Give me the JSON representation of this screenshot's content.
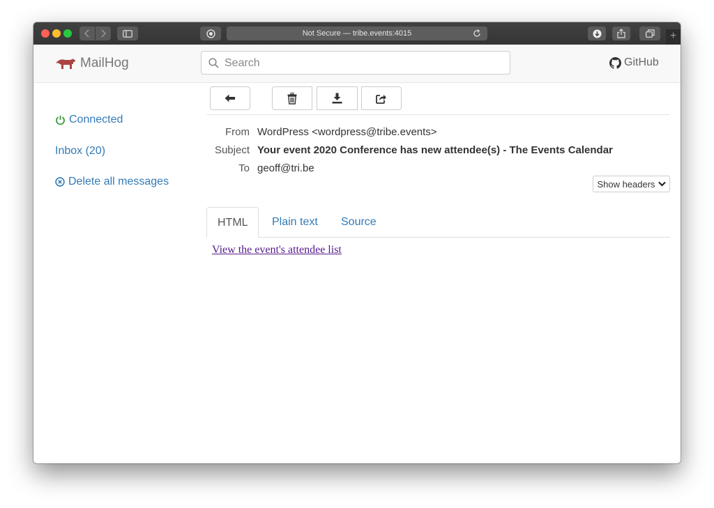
{
  "browser": {
    "address": "Not Secure — tribe.events:4015",
    "new_tab": "+"
  },
  "app": {
    "name": "MailHog",
    "search_placeholder": "Search",
    "github_label": "GitHub",
    "brand_color": "#a94442"
  },
  "sidebar": {
    "connected": "Connected",
    "inbox": "Inbox (20)",
    "delete_all": "Delete all messages"
  },
  "toolbar": {
    "buttons": [
      "back-arrow-icon",
      "trash-icon",
      "download-icon",
      "release-icon"
    ]
  },
  "message": {
    "from_label": "From",
    "from": "WordPress <wordpress@tribe.events>",
    "subject_label": "Subject",
    "subject": "Your event 2020 Conference has new attendee(s) - The Events Calendar",
    "to_label": "To",
    "to": "geoff@tri.be",
    "show_headers": "Show headers"
  },
  "tabs": {
    "items": [
      "HTML",
      "Plain text",
      "Source"
    ],
    "active": "HTML"
  },
  "content": {
    "link_text": "View the event's attendee list"
  }
}
